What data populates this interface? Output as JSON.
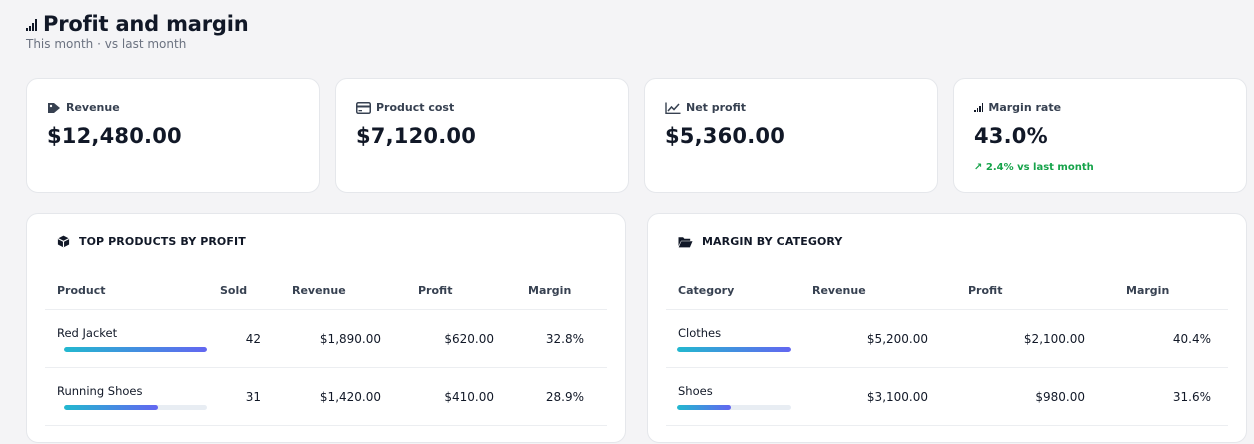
{
  "header": {
    "title": "Profit and margin",
    "subtitle": "This month · vs last month",
    "icon": "signal-bars-icon"
  },
  "kpis": [
    {
      "label": "Revenue",
      "value": "$12,480.00",
      "icon": "tag-icon"
    },
    {
      "label": "Product cost",
      "value": "$7,120.00",
      "icon": "credit-card-icon"
    },
    {
      "label": "Net profit",
      "value": "$5,360.00",
      "icon": "line-chart-icon"
    },
    {
      "label": "Margin rate",
      "value": "43.0%",
      "icon": "signal-bars-icon",
      "delta": "↗ 2.4% vs last month",
      "delta_color": "#16a34a"
    }
  ],
  "top_products": {
    "title": "TOP PRODUCTS BY PROFIT",
    "icon": "box-icon",
    "columns": [
      "Product",
      "Sold",
      "Revenue",
      "Profit",
      "Margin"
    ],
    "rows": [
      {
        "product": "Red Jacket",
        "sold": "42",
        "revenue": "$1,890.00",
        "profit": "$620.00",
        "margin": "32.8%",
        "bar_fraction": 1.0
      },
      {
        "product": "Running Shoes",
        "sold": "31",
        "revenue": "$1,420.00",
        "profit": "$410.00",
        "margin": "28.9%",
        "bar_fraction": 0.66
      }
    ]
  },
  "margin_by_category": {
    "title": "MARGIN BY CATEGORY",
    "icon": "folder-open-icon",
    "columns": [
      "Category",
      "Revenue",
      "Profit",
      "Margin"
    ],
    "rows": [
      {
        "category": "Clothes",
        "revenue": "$5,200.00",
        "profit": "$2,100.00",
        "margin": "40.4%",
        "bar_fraction": 1.0
      },
      {
        "category": "Shoes",
        "revenue": "$3,100.00",
        "profit": "$980.00",
        "margin": "31.6%",
        "bar_fraction": 0.47
      }
    ]
  },
  "colors": {
    "bar_start": "#22b8cf",
    "bar_end": "#6366f1",
    "positive": "#16a34a"
  }
}
